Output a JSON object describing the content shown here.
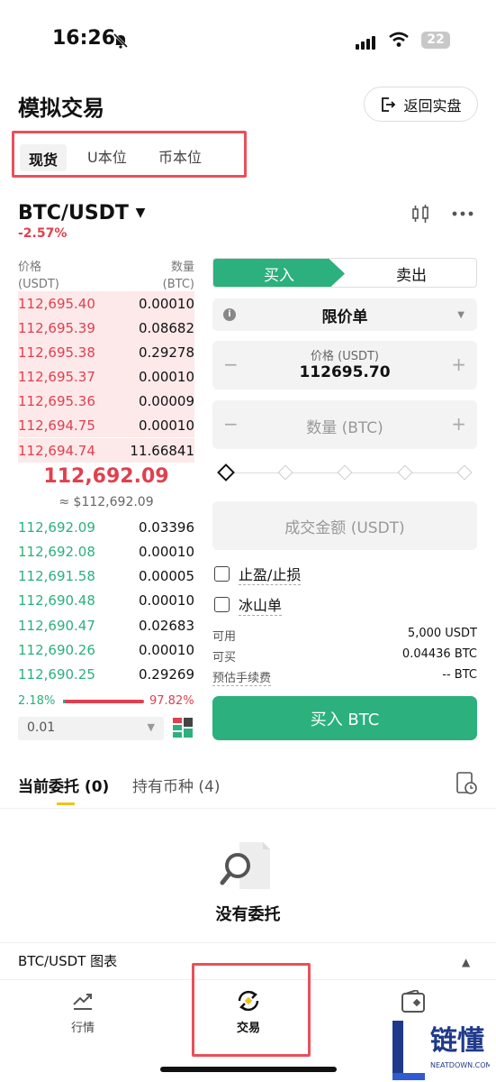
{
  "status_bar": {
    "time": "16:26",
    "battery": "22"
  },
  "header": {
    "title": "模拟交易",
    "back_label": "返回实盘"
  },
  "tabs": [
    "现货",
    "U本位",
    "币本位"
  ],
  "pair": {
    "symbol": "BTC/USDT",
    "change": "-2.57%"
  },
  "orderbook": {
    "price_header": "价格",
    "price_unit": "(USDT)",
    "qty_header": "数量",
    "qty_unit": "(BTC)",
    "asks": [
      {
        "price": "112,695.40",
        "qty": "0.00010"
      },
      {
        "price": "112,695.39",
        "qty": "0.08682"
      },
      {
        "price": "112,695.38",
        "qty": "0.29278"
      },
      {
        "price": "112,695.37",
        "qty": "0.00010"
      },
      {
        "price": "112,695.36",
        "qty": "0.00009"
      },
      {
        "price": "112,694.75",
        "qty": "0.00010"
      },
      {
        "price": "112,694.74",
        "qty": "11.66841"
      }
    ],
    "mid_price": "112,692.09",
    "mid_usd": "≈ $112,692.09",
    "bids": [
      {
        "price": "112,692.09",
        "qty": "0.03396"
      },
      {
        "price": "112,692.08",
        "qty": "0.00010"
      },
      {
        "price": "112,691.58",
        "qty": "0.00005"
      },
      {
        "price": "112,690.48",
        "qty": "0.00010"
      },
      {
        "price": "112,690.47",
        "qty": "0.02683"
      },
      {
        "price": "112,690.26",
        "qty": "0.00010"
      },
      {
        "price": "112,690.25",
        "qty": "0.29269"
      }
    ],
    "bid_ratio": "2.18%",
    "ask_ratio": "97.82%",
    "depth": "0.01"
  },
  "order_form": {
    "buy": "买入",
    "sell": "卖出",
    "order_type": "限价单",
    "price_label": "价格 (USDT)",
    "price_value": "112695.70",
    "qty_placeholder": "数量 (BTC)",
    "amount_placeholder": "成交金额 (USDT)",
    "tp_sl": "止盈/止损",
    "iceberg": "冰山单",
    "available_label": "可用",
    "available_value": "5,000 USDT",
    "can_buy_label": "可买",
    "can_buy_value": "0.04436 BTC",
    "fee_label": "预估手续费",
    "fee_value": "-- BTC",
    "submit": "买入 BTC"
  },
  "orders": {
    "open_tab": "当前委托 (0)",
    "holdings_tab": "持有币种 (4)",
    "empty": "没有委托"
  },
  "chart_bar": {
    "label": "BTC/USDT 图表"
  },
  "nav": {
    "market": "行情",
    "trade": "交易"
  },
  "logo": {
    "text": "链懂",
    "sub": "NEATDOWN.COM"
  },
  "colors": {
    "green": "#2bb07e",
    "red": "#e0404e",
    "highlight": "#e8505b"
  }
}
